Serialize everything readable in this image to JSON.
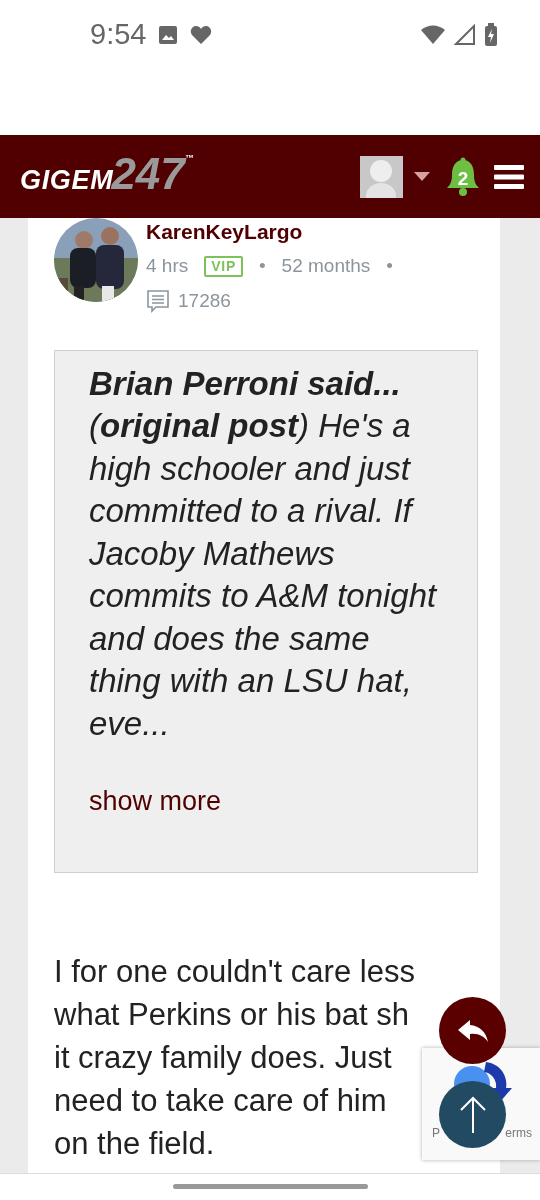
{
  "status_bar": {
    "time": "9:54"
  },
  "header": {
    "logo": {
      "word": "GIGEM",
      "number": "247",
      "mark": "™"
    },
    "notifications": "2"
  },
  "post": {
    "author": "KarenKeyLargo",
    "age": "4 hrs",
    "badge": "VIP",
    "tenure": "52 months",
    "separator": "•",
    "post_count": "17286",
    "quote": {
      "text": "**Brian Perroni said...** (**original post**) He's a high schooler and just committed to a rival. If Jacoby Mathews commits to A&M tonight and does the same thing with an LSU hat, eve...",
      "show_more": "show more"
    },
    "body": "I for one couldn't care less what Perkins or his bat sh it crazy family does. Just need to take care of him on the field."
  },
  "recaptcha": {
    "left": "P",
    "right": "erms"
  }
}
